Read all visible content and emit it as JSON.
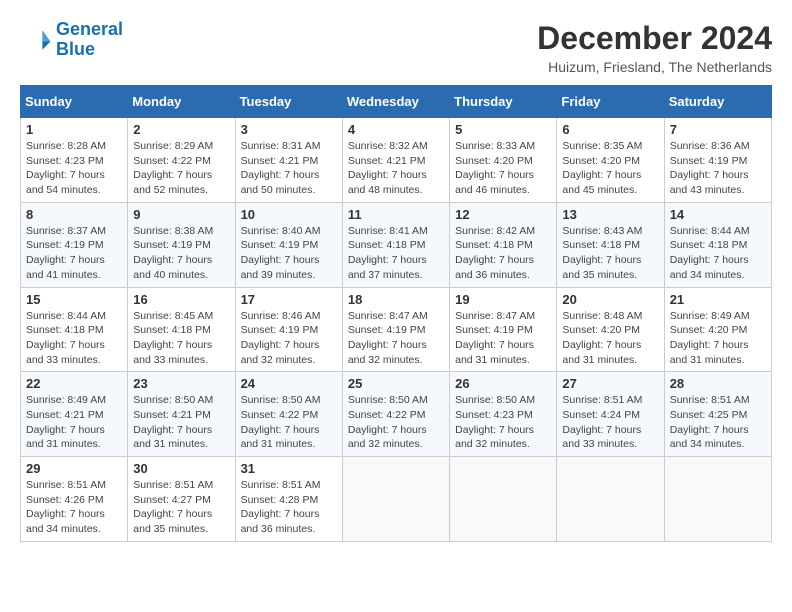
{
  "header": {
    "logo_line1": "General",
    "logo_line2": "Blue",
    "month": "December 2024",
    "location": "Huizum, Friesland, The Netherlands"
  },
  "columns": [
    "Sunday",
    "Monday",
    "Tuesday",
    "Wednesday",
    "Thursday",
    "Friday",
    "Saturday"
  ],
  "weeks": [
    [
      {
        "day": "1",
        "sunrise": "8:28 AM",
        "sunset": "4:23 PM",
        "daylight": "7 hours and 54 minutes."
      },
      {
        "day": "2",
        "sunrise": "8:29 AM",
        "sunset": "4:22 PM",
        "daylight": "7 hours and 52 minutes."
      },
      {
        "day": "3",
        "sunrise": "8:31 AM",
        "sunset": "4:21 PM",
        "daylight": "7 hours and 50 minutes."
      },
      {
        "day": "4",
        "sunrise": "8:32 AM",
        "sunset": "4:21 PM",
        "daylight": "7 hours and 48 minutes."
      },
      {
        "day": "5",
        "sunrise": "8:33 AM",
        "sunset": "4:20 PM",
        "daylight": "7 hours and 46 minutes."
      },
      {
        "day": "6",
        "sunrise": "8:35 AM",
        "sunset": "4:20 PM",
        "daylight": "7 hours and 45 minutes."
      },
      {
        "day": "7",
        "sunrise": "8:36 AM",
        "sunset": "4:19 PM",
        "daylight": "7 hours and 43 minutes."
      }
    ],
    [
      {
        "day": "8",
        "sunrise": "8:37 AM",
        "sunset": "4:19 PM",
        "daylight": "7 hours and 41 minutes."
      },
      {
        "day": "9",
        "sunrise": "8:38 AM",
        "sunset": "4:19 PM",
        "daylight": "7 hours and 40 minutes."
      },
      {
        "day": "10",
        "sunrise": "8:40 AM",
        "sunset": "4:19 PM",
        "daylight": "7 hours and 39 minutes."
      },
      {
        "day": "11",
        "sunrise": "8:41 AM",
        "sunset": "4:18 PM",
        "daylight": "7 hours and 37 minutes."
      },
      {
        "day": "12",
        "sunrise": "8:42 AM",
        "sunset": "4:18 PM",
        "daylight": "7 hours and 36 minutes."
      },
      {
        "day": "13",
        "sunrise": "8:43 AM",
        "sunset": "4:18 PM",
        "daylight": "7 hours and 35 minutes."
      },
      {
        "day": "14",
        "sunrise": "8:44 AM",
        "sunset": "4:18 PM",
        "daylight": "7 hours and 34 minutes."
      }
    ],
    [
      {
        "day": "15",
        "sunrise": "8:44 AM",
        "sunset": "4:18 PM",
        "daylight": "7 hours and 33 minutes."
      },
      {
        "day": "16",
        "sunrise": "8:45 AM",
        "sunset": "4:18 PM",
        "daylight": "7 hours and 33 minutes."
      },
      {
        "day": "17",
        "sunrise": "8:46 AM",
        "sunset": "4:19 PM",
        "daylight": "7 hours and 32 minutes."
      },
      {
        "day": "18",
        "sunrise": "8:47 AM",
        "sunset": "4:19 PM",
        "daylight": "7 hours and 32 minutes."
      },
      {
        "day": "19",
        "sunrise": "8:47 AM",
        "sunset": "4:19 PM",
        "daylight": "7 hours and 31 minutes."
      },
      {
        "day": "20",
        "sunrise": "8:48 AM",
        "sunset": "4:20 PM",
        "daylight": "7 hours and 31 minutes."
      },
      {
        "day": "21",
        "sunrise": "8:49 AM",
        "sunset": "4:20 PM",
        "daylight": "7 hours and 31 minutes."
      }
    ],
    [
      {
        "day": "22",
        "sunrise": "8:49 AM",
        "sunset": "4:21 PM",
        "daylight": "7 hours and 31 minutes."
      },
      {
        "day": "23",
        "sunrise": "8:50 AM",
        "sunset": "4:21 PM",
        "daylight": "7 hours and 31 minutes."
      },
      {
        "day": "24",
        "sunrise": "8:50 AM",
        "sunset": "4:22 PM",
        "daylight": "7 hours and 31 minutes."
      },
      {
        "day": "25",
        "sunrise": "8:50 AM",
        "sunset": "4:22 PM",
        "daylight": "7 hours and 32 minutes."
      },
      {
        "day": "26",
        "sunrise": "8:50 AM",
        "sunset": "4:23 PM",
        "daylight": "7 hours and 32 minutes."
      },
      {
        "day": "27",
        "sunrise": "8:51 AM",
        "sunset": "4:24 PM",
        "daylight": "7 hours and 33 minutes."
      },
      {
        "day": "28",
        "sunrise": "8:51 AM",
        "sunset": "4:25 PM",
        "daylight": "7 hours and 34 minutes."
      }
    ],
    [
      {
        "day": "29",
        "sunrise": "8:51 AM",
        "sunset": "4:26 PM",
        "daylight": "7 hours and 34 minutes."
      },
      {
        "day": "30",
        "sunrise": "8:51 AM",
        "sunset": "4:27 PM",
        "daylight": "7 hours and 35 minutes."
      },
      {
        "day": "31",
        "sunrise": "8:51 AM",
        "sunset": "4:28 PM",
        "daylight": "7 hours and 36 minutes."
      },
      null,
      null,
      null,
      null
    ]
  ]
}
